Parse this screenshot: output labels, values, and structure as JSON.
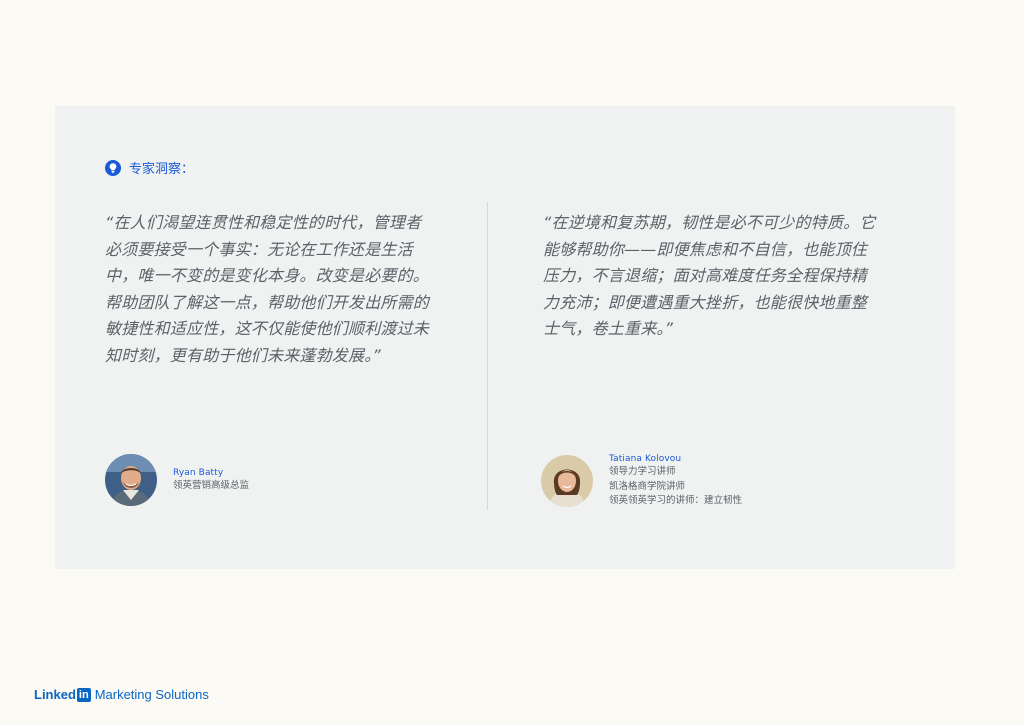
{
  "insight": {
    "label": "专家洞察：",
    "icon": "lightbulb-icon",
    "accent": "#1a5ad7"
  },
  "quotes": [
    {
      "text": "“在人们渴望连贯性和稳定性的时代，管理者必须要接受一个事实：无论在工作还是生活中，唯一不变的是变化本身。改变是必要的。帮助团队了解这一点，帮助他们开发出所需的敏捷性和适应性，这不仅能使他们顺利渡过未知时刻，更有助于他们未来蓬勃发展。”",
      "author": {
        "name": "Ryan Batty",
        "role": "领英营销高级总监"
      }
    },
    {
      "text": "“在逆境和复苏期，韧性是必不可少的特质。它能够帮助你——即便焦虑和不自信，也能顶住压力，不言退缩；面对高难度任务全程保持精力充沛；即便遭遇重大挫折，也能很快地重整士气，卷土重来。”",
      "author": {
        "name": "Tatiana Kolovou",
        "role_lines": [
          "领导力学习讲师",
          "凯洛格商学院讲师",
          "领英领英学习的讲师：建立韧性"
        ]
      }
    }
  ],
  "footer": {
    "logo_linked": "Linked",
    "logo_in": "in",
    "logo_suffix": "Marketing Solutions",
    "brand_color": "#0a66c2"
  }
}
